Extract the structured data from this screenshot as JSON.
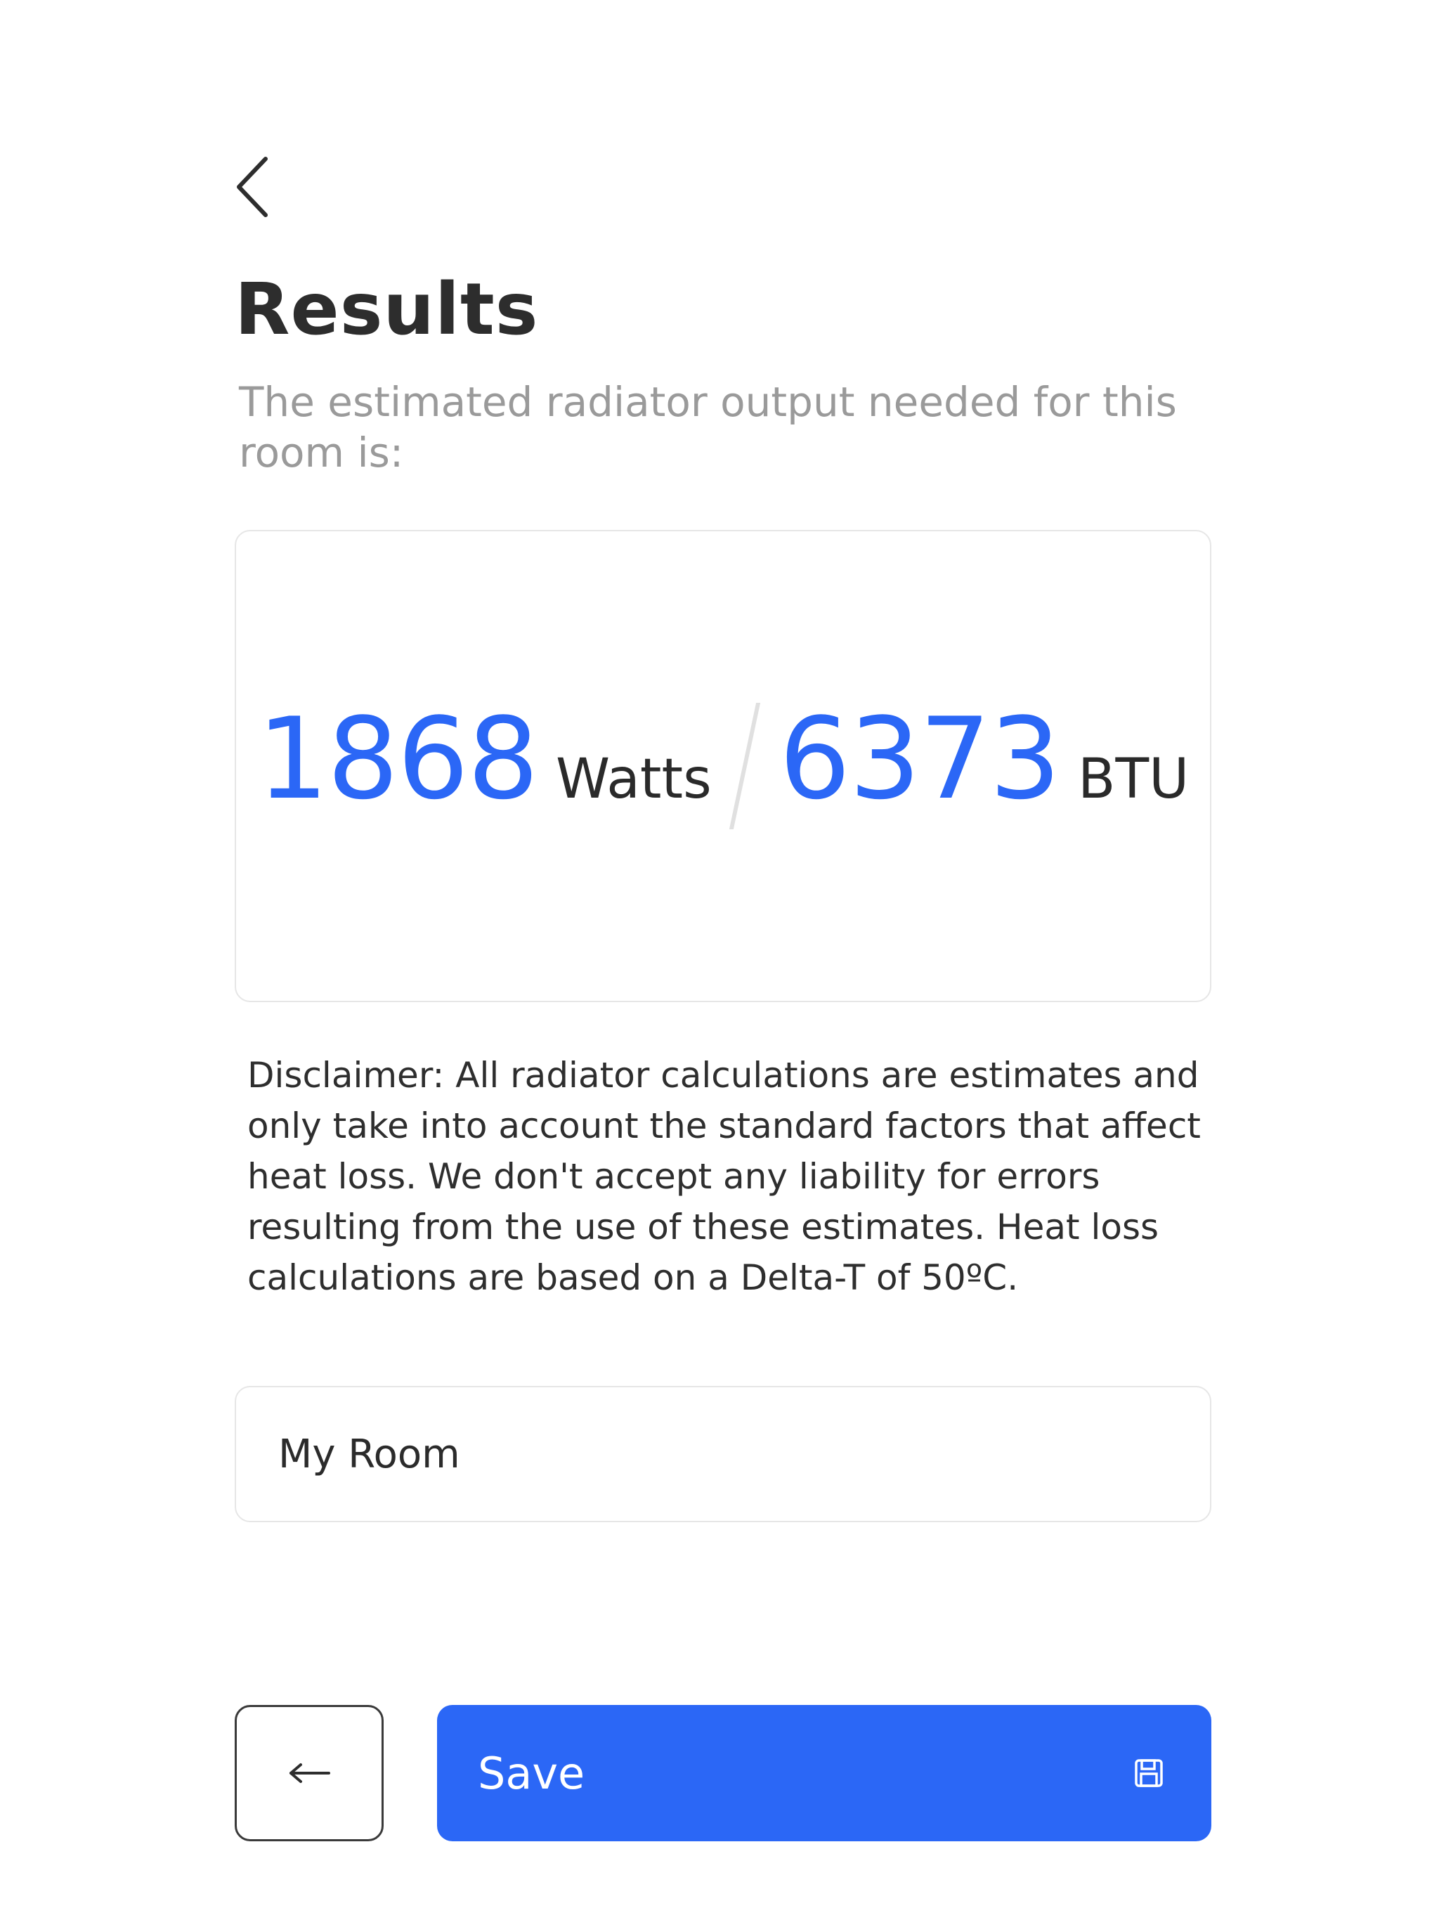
{
  "header": {
    "back_icon": "chevron-left-icon",
    "title": "Results",
    "subtitle": "The estimated radiator output needed for this room is:"
  },
  "result": {
    "watts_value": "1868",
    "watts_unit": "Watts",
    "separator_icon": "slash-divider",
    "btu_value": "6373",
    "btu_unit": "BTU"
  },
  "disclaimer": "Disclaimer: All radiator calculations are estimates and only take into account the standard factors that affect heat loss. We don't accept any liability for errors resulting from the use of these estimates. Heat loss calculations are based on a Delta-T of 50ºC.",
  "room_name": {
    "value": "My Room",
    "placeholder": ""
  },
  "footer": {
    "back_icon": "arrow-left-icon",
    "save_label": "Save",
    "save_icon": "floppy-disk-icon"
  },
  "colors": {
    "accent": "#2b67f6",
    "text": "#2b2b2b",
    "muted": "#9a9a9a",
    "border": "#e6e6e6"
  }
}
